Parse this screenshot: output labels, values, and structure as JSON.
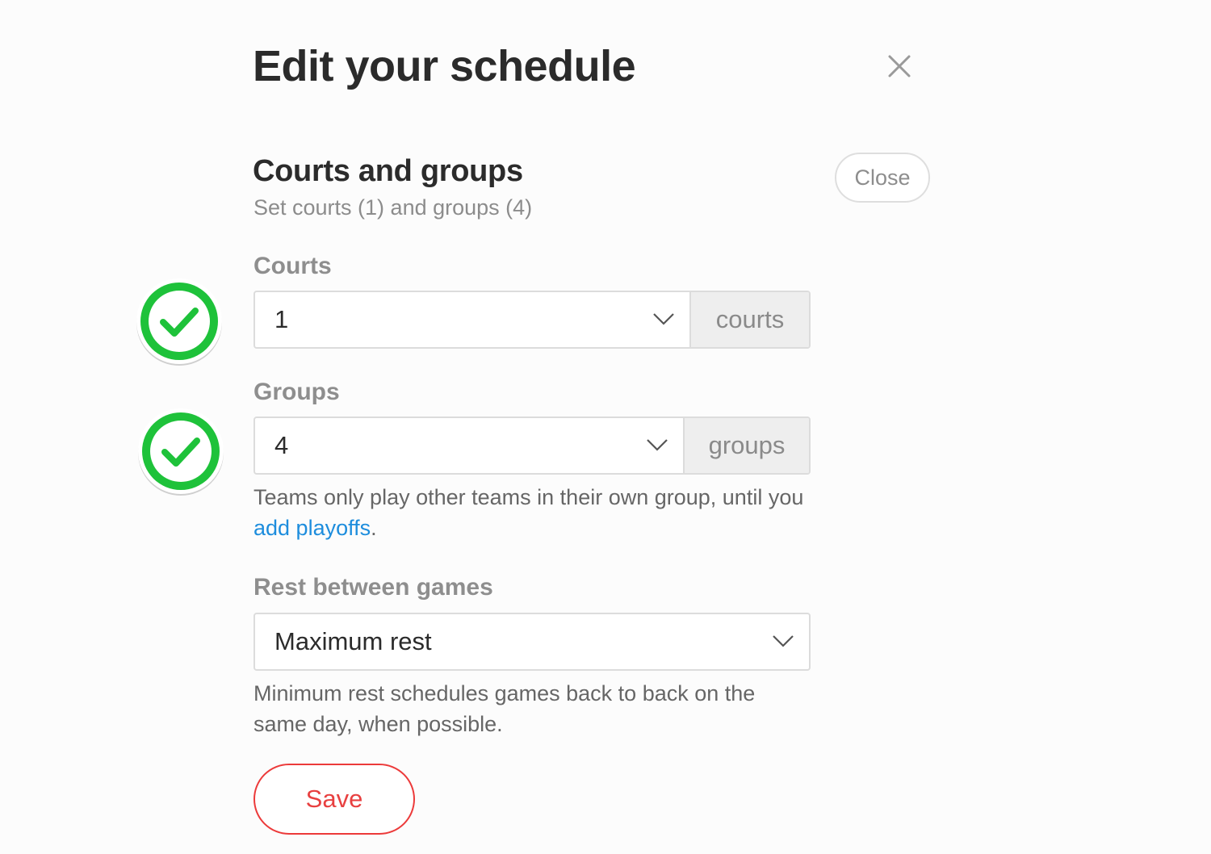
{
  "header": {
    "title": "Edit your schedule",
    "close_icon": "close-icon"
  },
  "section": {
    "title": "Courts and groups",
    "subtitle": "Set courts (1) and groups (4)",
    "close_label": "Close"
  },
  "courts": {
    "label": "Courts",
    "value": "1",
    "unit": "courts",
    "status_icon": "check-circle-icon"
  },
  "groups": {
    "label": "Groups",
    "value": "4",
    "unit": "groups",
    "status_icon": "check-circle-icon",
    "help_prefix": "Teams only play other teams in their own group, until you ",
    "help_link": "add playoffs",
    "help_suffix": "."
  },
  "rest": {
    "label": "Rest between games",
    "value": "Maximum rest",
    "help": "Minimum rest schedules games back to back on the same day, when possible."
  },
  "actions": {
    "save_label": "Save"
  },
  "colors": {
    "accent_red": "#e84040",
    "link_blue": "#1d8ddd",
    "check_green": "#1ec23a"
  }
}
